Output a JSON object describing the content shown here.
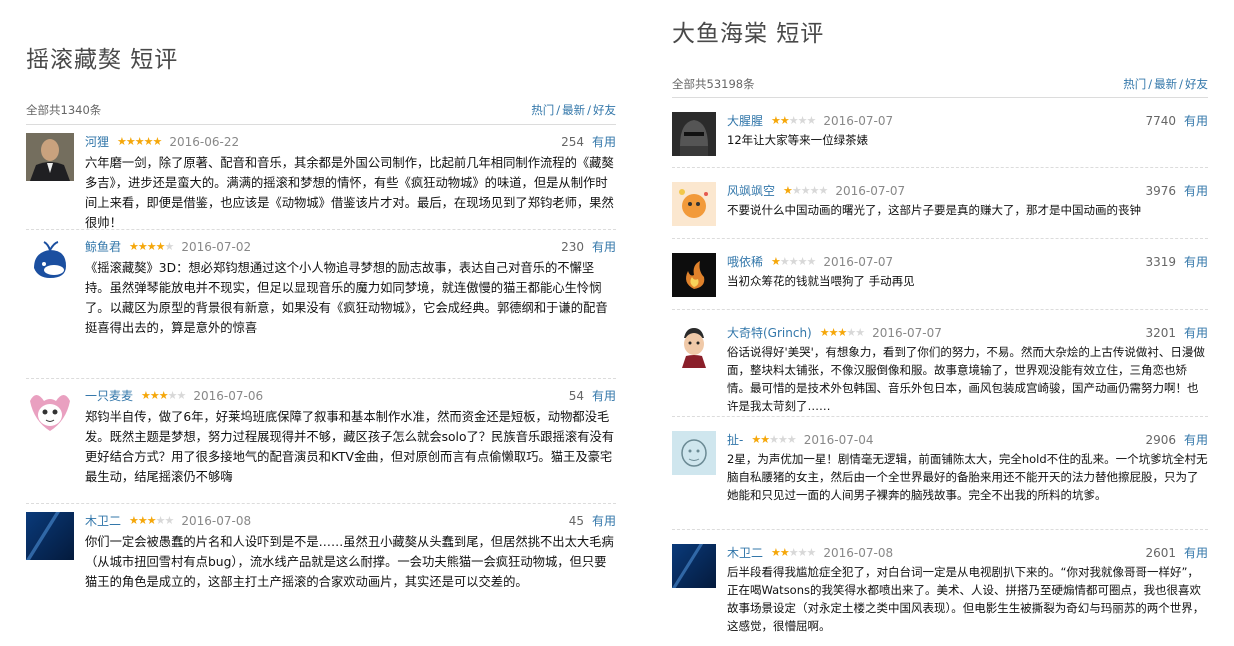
{
  "left": {
    "title": "摇滚藏獒 短评",
    "total": "全部共1340条",
    "sort": [
      "热门",
      "最新",
      "好友"
    ],
    "comments": [
      {
        "user": "河狸",
        "stars": 5,
        "date": "2016-06-22",
        "votes": "254",
        "useful": "有用",
        "avatar_icon": "avatar-man-in-suit",
        "text": "六年磨一剑，除了原著、配音和音乐，其余都是外国公司制作，比起前几年相同制作流程的《藏獒多吉》，进步还是蛮大的。满满的摇滚和梦想的情怀，有些《疯狂动物城》的味道，但是从制作时间上来看，即便是借鉴，也应该是《动物城》借鉴该片才对。最后，在现场见到了郑钧老师，果然很帅！"
      },
      {
        "user": "鲸鱼君",
        "stars": 4,
        "date": "2016-07-02",
        "votes": "230",
        "useful": "有用",
        "avatar_icon": "avatar-blue-whale",
        "text": "《摇滚藏獒》3D：想必郑钧想通过这个小人物追寻梦想的励志故事，表达自己对音乐的不懈坚持。虽然弹琴能放电并不现实，但足以显现音乐的魔力如同梦境，就连傲慢的猫王都能心生怜悯了。以藏区为原型的背景很有新意，如果没有《疯狂动物城》，它会成经典。郭德纲和于谦的配音挺喜得出去的，算是意外的惊喜"
      },
      {
        "user": "一只麦麦",
        "stars": 3,
        "date": "2016-07-06",
        "votes": "54",
        "useful": "有用",
        "avatar_icon": "avatar-cartoon-fox",
        "text": "郑钧半自传，做了6年，好莱坞班底保障了叙事和基本制作水准，然而资金还是短板，动物都没毛发。既然主题是梦想，努力过程展现得并不够，藏区孩子怎么就会solo了？民族音乐跟摇滚有没有更好结合方式？用了很多接地气的配音演员和KTV金曲，但对原创而言有点偷懒取巧。猫王及豪宅最生动，结尾摇滚仍不够嗨"
      },
      {
        "user": "木卫二",
        "stars": 3,
        "date": "2016-07-08",
        "votes": "45",
        "useful": "有用",
        "avatar_icon": "avatar-blue-space",
        "text": "你们一定会被愚蠢的片名和人设吓到是不是……虽然丑小藏獒从头蠢到尾，但居然挑不出太大毛病（从城市扭回雪村有点bug），流水线产品就是这么耐撑。一会功夫熊猫一会疯狂动物城，但只要猫王的角色是成立的，这部主打土产摇滚的合家欢动画片，其实还是可以交差的。"
      }
    ]
  },
  "right": {
    "title": "大鱼海棠 短评",
    "total": "全部共53198条",
    "sort": [
      "热门",
      "最新",
      "好友"
    ],
    "comments": [
      {
        "user": "大腥腥",
        "stars": 2,
        "date": "2016-07-07",
        "votes": "7740",
        "useful": "有用",
        "avatar_icon": "avatar-dark-helmet",
        "text": "12年让大家等来一位绿茶婊"
      },
      {
        "user": "风飒飒空",
        "stars": 1,
        "date": "2016-07-07",
        "votes": "3976",
        "useful": "有用",
        "avatar_icon": "avatar-orange-cartoon",
        "text": "不要说什么中国动画的曙光了，这部片子要是真的赚大了，那才是中国动画的丧钟"
      },
      {
        "user": "哦依稀",
        "stars": 1,
        "date": "2016-07-07",
        "votes": "3319",
        "useful": "有用",
        "avatar_icon": "avatar-fire-dark",
        "text": "当初众筹花的钱就当喂狗了 手动再见"
      },
      {
        "user": "大奇特(Grinch)",
        "stars": 3,
        "date": "2016-07-07",
        "votes": "3201",
        "useful": "有用",
        "avatar_icon": "avatar-cartoon-man",
        "text": "俗话说得好'美哭'，有想象力，看到了你们的努力，不易。然而大杂烩的上古传说做衬、日漫做面，整块料太铺张，不像汉服倒像和服。故事意境输了，世界观没能有效立住，三角恋也矫情。最可惜的是技术外包韩国、音乐外包日本，画风包装成宫崎骏，国产动画仍需努力啊！也许是我太苛刻了……"
      },
      {
        "user": "扯-",
        "stars": 2,
        "date": "2016-07-04",
        "votes": "2906",
        "useful": "有用",
        "avatar_icon": "avatar-sketch-face",
        "text": "2星，为声优加一星！剧情毫无逻辑，前面铺陈太大，完全hold不住的乱来。一个坑爹坑全村无脑自私腰猪的女主，然后由一个全世界最好的备胎来用还不能开天的法力替他擦屁股，只为了她能和只见过一面的人间男子裸奔的脑残故事。完全不出我的所料的坑爹。"
      },
      {
        "user": "木卫二",
        "stars": 2,
        "date": "2016-07-08",
        "votes": "2601",
        "useful": "有用",
        "avatar_icon": "avatar-blue-space",
        "text": "后半段看得我尴尬症全犯了，对白台词一定是从电视剧扒下来的。“你对我就像哥哥一样好”，正在喝Watsons的我笑得水都喷出来了。美术、人设、拼搭乃至硬煽情都可圈点，我也很喜欢故事场景设定（对永定土楼之类中国风表现）。但电影生生被撕裂为奇幻与玛丽苏的两个世界，这感觉，很懵屈啊。"
      }
    ]
  }
}
